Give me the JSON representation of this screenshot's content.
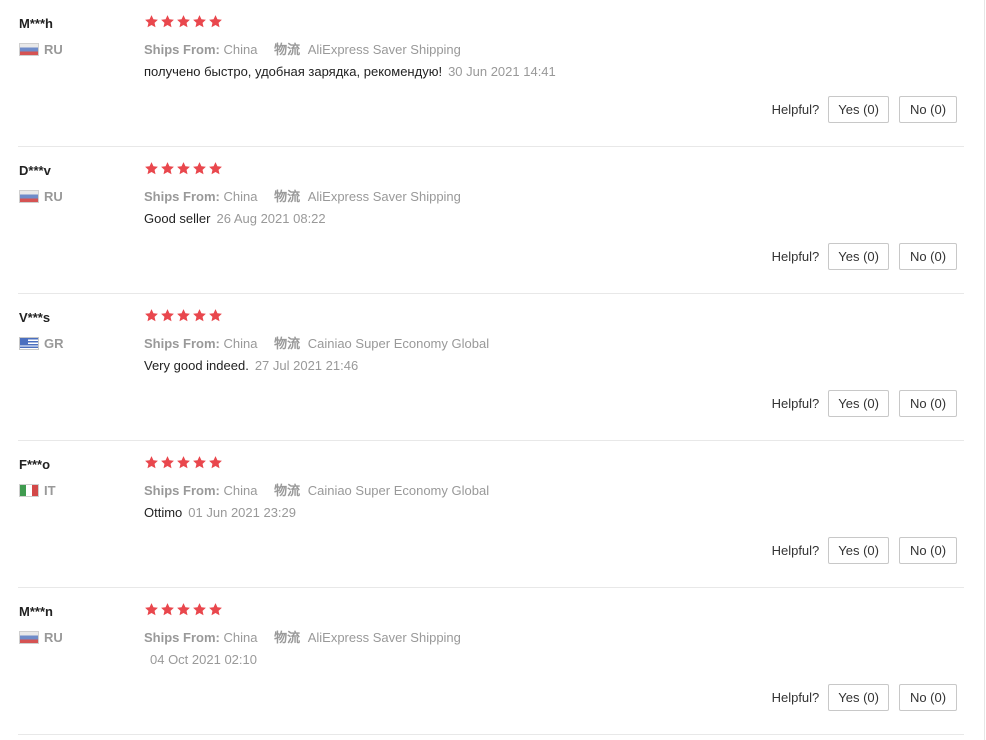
{
  "labels": {
    "ships_from": "Ships From:",
    "logistics": "物流",
    "helpful": "Helpful?"
  },
  "colors": {
    "star": "#e9474d",
    "muted_text": "#999999",
    "divider": "#e8e8e8"
  },
  "reviews": [
    {
      "user": "M***h",
      "flag": "russia-flag-icon",
      "country": "RU",
      "rating": 5,
      "ships_from": "China",
      "logistics": "AliExpress Saver Shipping",
      "text": "получено быстро, удобная зарядка, рекомендую!",
      "date": "30 Jun 2021 14:41",
      "yes": "Yes (0)",
      "no": "No (0)"
    },
    {
      "user": "D***v",
      "flag": "russia-flag-icon",
      "country": "RU",
      "rating": 5,
      "ships_from": "China",
      "logistics": "AliExpress Saver Shipping",
      "text": "Good seller",
      "date": "26 Aug 2021 08:22",
      "yes": "Yes (0)",
      "no": "No (0)"
    },
    {
      "user": "V***s",
      "flag": "greece-flag-icon",
      "country": "GR",
      "rating": 5,
      "ships_from": "China",
      "logistics": "Cainiao Super Economy Global",
      "text": "Very good indeed.",
      "date": "27 Jul 2021 21:46",
      "yes": "Yes (0)",
      "no": "No (0)"
    },
    {
      "user": "F***o",
      "flag": "italy-flag-icon",
      "country": "IT",
      "rating": 5,
      "ships_from": "China",
      "logistics": "Cainiao Super Economy Global",
      "text": "Ottimo",
      "date": "01 Jun 2021 23:29",
      "yes": "Yes (0)",
      "no": "No (0)"
    },
    {
      "user": "M***n",
      "flag": "russia-flag-icon",
      "country": "RU",
      "rating": 5,
      "ships_from": "China",
      "logistics": "AliExpress Saver Shipping",
      "text": "",
      "date": "04 Oct 2021 02:10",
      "yes": "Yes (0)",
      "no": "No (0)"
    }
  ]
}
